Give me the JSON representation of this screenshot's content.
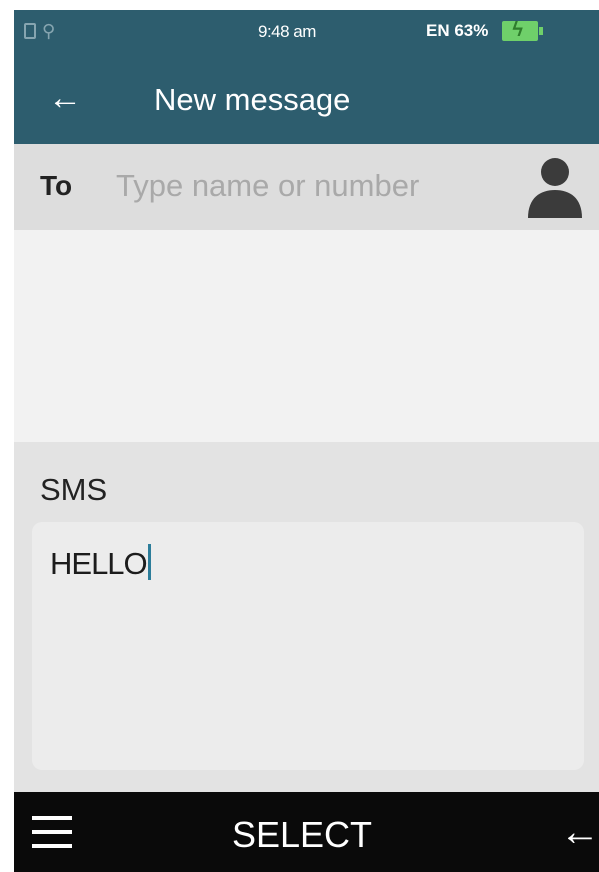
{
  "status_bar": {
    "time": "9:48 am",
    "language_battery": "EN 63%",
    "icons": [
      "sim-card-icon",
      "usb-icon",
      "battery-charging-icon"
    ]
  },
  "app_bar": {
    "title": "New message",
    "back_icon": "arrow-left-icon"
  },
  "recipient": {
    "label": "To",
    "value": "",
    "placeholder": "Type name or number",
    "contact_icon": "contact-person-icon"
  },
  "message": {
    "section_label": "SMS",
    "body": "HELLO"
  },
  "softkeys": {
    "left_icon": "menu-icon",
    "center_label": "SELECT",
    "right_icon": "back-arrow-icon"
  },
  "colors": {
    "header": "#2d5d6e",
    "battery": "#6fd06a",
    "softkey_bar": "#0a0a0a",
    "cursor": "#2c7d9a"
  }
}
